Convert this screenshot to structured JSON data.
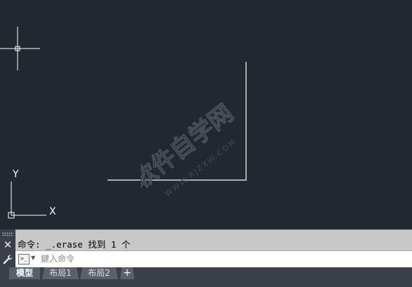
{
  "watermark": {
    "text": "软件自学网",
    "url": "WWW.RJZXW.COM"
  },
  "ucs": {
    "x_label": "X",
    "y_label": "Y"
  },
  "command": {
    "history_line": "命令: _.erase 找到 1 个",
    "input_placeholder": "鍵入命令",
    "prompt_icon": ">_"
  },
  "tabs": [
    {
      "label": "模型",
      "active": true
    },
    {
      "label": "布局1",
      "active": false
    },
    {
      "label": "布局2",
      "active": false
    }
  ],
  "add_tab_label": "+",
  "colors": {
    "canvas_bg": "#212830",
    "geometry": "#ffffff",
    "command_history_bg": "#c8c8c8",
    "command_input_bg": "#ffffff",
    "chrome_bg": "#3b4048"
  }
}
